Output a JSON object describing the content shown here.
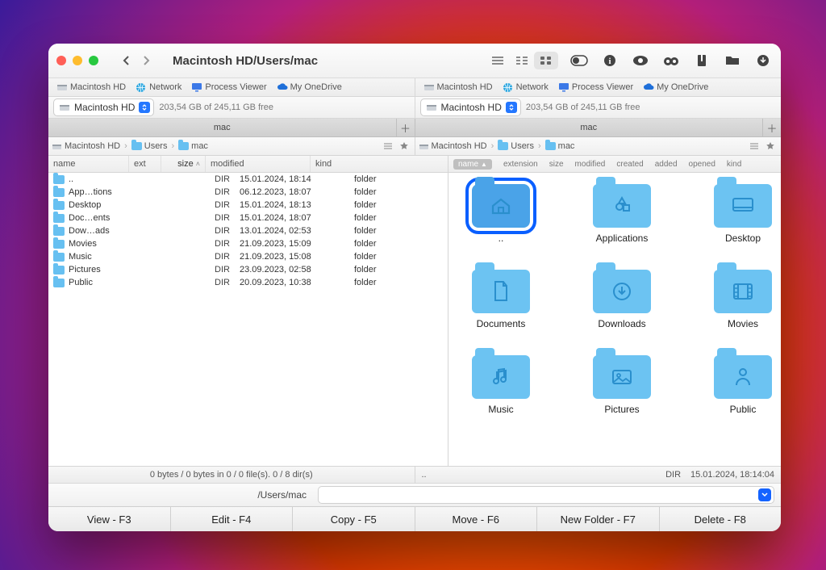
{
  "window_title": "Macintosh HD/Users/mac",
  "favorites": [
    {
      "label": "Macintosh HD",
      "icon": "disk"
    },
    {
      "label": "Network",
      "icon": "globe"
    },
    {
      "label": "Process Viewer",
      "icon": "monitor"
    },
    {
      "label": "My OneDrive",
      "icon": "cloud"
    }
  ],
  "volume": {
    "selected": "Macintosh HD",
    "free": "203,54 GB of 245,11 GB free"
  },
  "tab": {
    "label": "mac"
  },
  "breadcrumb": [
    {
      "label": "Macintosh HD",
      "icon": "disk"
    },
    {
      "label": "Users",
      "icon": "folder"
    },
    {
      "label": "mac",
      "icon": "folder"
    }
  ],
  "list_columns": {
    "name": "name",
    "ext": "ext",
    "size": "size",
    "modified": "modified",
    "kind": "kind"
  },
  "list_rows": [
    {
      "name": "..",
      "size": "DIR",
      "modified": "15.01.2024, 18:14",
      "kind": "folder"
    },
    {
      "name": "App…tions",
      "size": "DIR",
      "modified": "06.12.2023, 18:07",
      "kind": "folder"
    },
    {
      "name": "Desktop",
      "size": "DIR",
      "modified": "15.01.2024, 18:13",
      "kind": "folder"
    },
    {
      "name": "Doc…ents",
      "size": "DIR",
      "modified": "15.01.2024, 18:07",
      "kind": "folder"
    },
    {
      "name": "Dow…ads",
      "size": "DIR",
      "modified": "13.01.2024, 02:53",
      "kind": "folder"
    },
    {
      "name": "Movies",
      "size": "DIR",
      "modified": "21.09.2023, 15:09",
      "kind": "folder"
    },
    {
      "name": "Music",
      "size": "DIR",
      "modified": "21.09.2023, 15:08",
      "kind": "folder"
    },
    {
      "name": "Pictures",
      "size": "DIR",
      "modified": "23.09.2023, 02:58",
      "kind": "folder"
    },
    {
      "name": "Public",
      "size": "DIR",
      "modified": "20.09.2023, 10:38",
      "kind": "folder"
    }
  ],
  "icon_columns": {
    "name": "name",
    "extension": "extension",
    "size": "size",
    "modified": "modified",
    "created": "created",
    "added": "added",
    "opened": "opened",
    "kind": "kind"
  },
  "icon_items": [
    {
      "name": "..",
      "glyph": "home",
      "selected": true
    },
    {
      "name": "Applications",
      "glyph": "app"
    },
    {
      "name": "Desktop",
      "glyph": "desktop"
    },
    {
      "name": "Documents",
      "glyph": "doc"
    },
    {
      "name": "Downloads",
      "glyph": "download"
    },
    {
      "name": "Movies",
      "glyph": "movie"
    },
    {
      "name": "Music",
      "glyph": "music"
    },
    {
      "name": "Pictures",
      "glyph": "picture"
    },
    {
      "name": "Public",
      "glyph": "public"
    }
  ],
  "status_left": "0 bytes / 0 bytes in 0 / 0 file(s). 0 / 8 dir(s)",
  "status_right_name": "..",
  "status_right_kind": "DIR",
  "status_right_date": "15.01.2024, 18:14:04",
  "path_label": "/Users/mac",
  "fkeys": [
    "View - F3",
    "Edit - F4",
    "Copy - F5",
    "Move - F6",
    "New Folder - F7",
    "Delete - F8"
  ]
}
